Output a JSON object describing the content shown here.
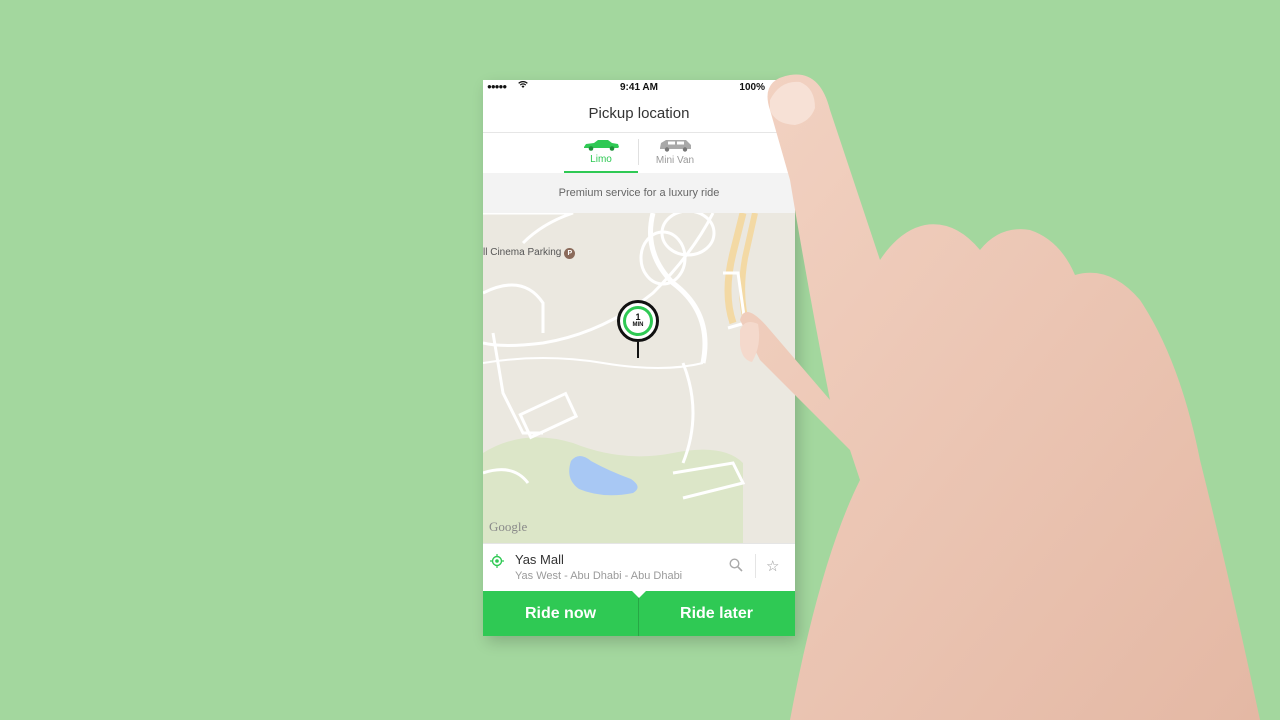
{
  "status_bar": {
    "signal": "●●●●●",
    "time": "9:41 AM",
    "battery": "100%"
  },
  "header": {
    "title": "Pickup location"
  },
  "vehicle_tabs": [
    {
      "label": "Limo",
      "selected": true
    },
    {
      "label": "Mini Van",
      "selected": false
    }
  ],
  "service_banner": "Premium service for a luxury ride",
  "map": {
    "poi_label": "ll Cinema Parking",
    "poi_icon": "P",
    "attribution": "Google",
    "pin": {
      "eta": "1",
      "unit": "MIN"
    }
  },
  "pickup": {
    "name": "Yas Mall",
    "address": "Yas West - Abu Dhabi - Abu Dhabi",
    "icons": [
      "location-target-icon",
      "search-icon",
      "star-icon"
    ]
  },
  "actions": {
    "ride_now": "Ride now",
    "ride_later": "Ride later"
  },
  "colors": {
    "background": "#a3d79e",
    "accent": "#2fc954",
    "map": "#ebe8e0",
    "water": "#a8c8f4"
  }
}
